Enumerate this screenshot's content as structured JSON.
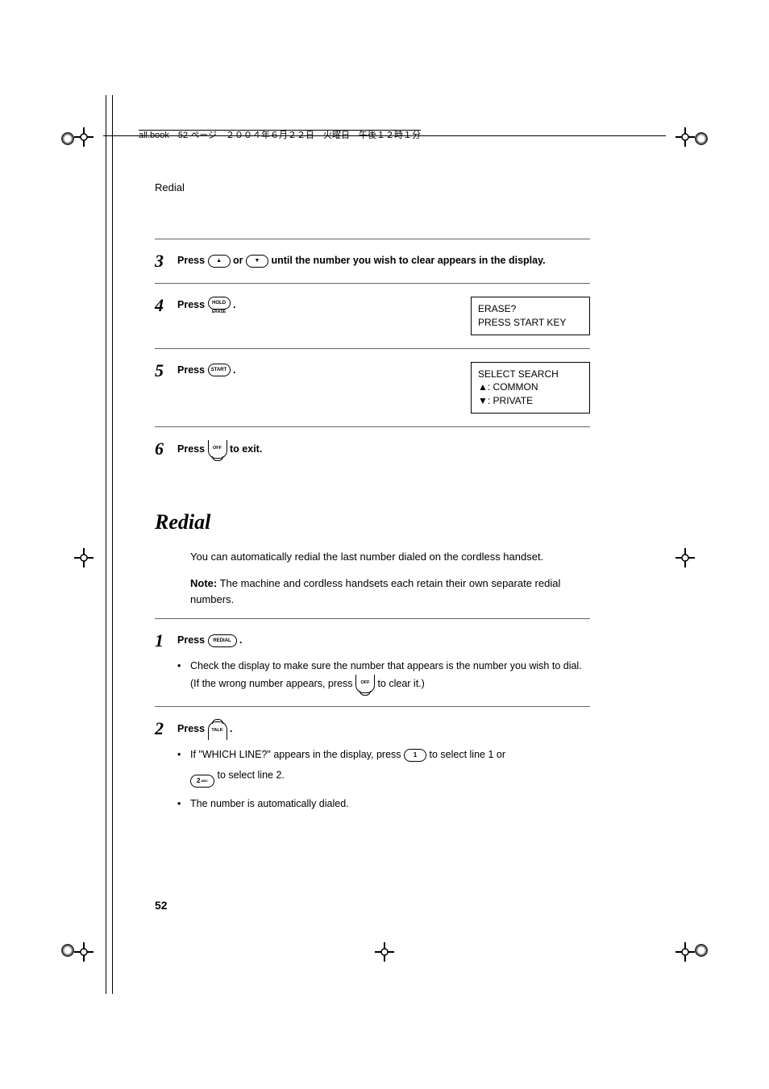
{
  "meta_line": "all.book　52 ページ　２００４年６月２２日　火曜日　午後１２時１分",
  "running_head": "Redial",
  "upper_steps": [
    {
      "num": "3",
      "text_before": "Press ",
      "text_mid": " or ",
      "text_after": " until the number you wish to clear appears in the display.",
      "icon1": "up-arrow-key",
      "icon2": "down-arrow-key"
    },
    {
      "num": "4",
      "text_before": "Press ",
      "text_after": " .",
      "icon": "hold-erase-key",
      "icon_main": "HOLD",
      "icon_sub": "ERASE",
      "display": [
        "ERASE?",
        "PRESS START KEY"
      ]
    },
    {
      "num": "5",
      "text_before": "Press ",
      "text_after": " .",
      "icon": "start-key",
      "icon_label": "START",
      "display": [
        "SELECT SEARCH",
        "▲: COMMON",
        "▼: PRIVATE"
      ]
    },
    {
      "num": "6",
      "text_before": "Press ",
      "text_after": " to exit.",
      "icon": "off-key",
      "icon_label": "OFF"
    }
  ],
  "section_title": "Redial",
  "intro_paras": [
    "You can automatically redial the last number dialed on the cordless handset."
  ],
  "note_label": "Note:",
  "note_text": " The machine and cordless handsets each retain their own separate redial numbers.",
  "lower_steps": [
    {
      "num": "1",
      "text_before": "Press ",
      "text_after": " .",
      "icon": "redial-key",
      "icon_label": "REDIAL",
      "bullets": [
        {
          "pre": "Check the display to make sure the number that appears is the number you wish to dial. (If the wrong number appears, press ",
          "mid_icon": "off-key",
          "mid_icon_label": "OFF",
          "post": " to clear it.)"
        }
      ]
    },
    {
      "num": "2",
      "text_before": "Press ",
      "text_after": " .",
      "icon": "talk-key",
      "icon_label": "TALK",
      "bullets": [
        {
          "pre": "If \"WHICH LINE?\" appears in the display, press ",
          "mid_icon": "key-1",
          "mid_icon_label": "1",
          "between": " to select line 1 or ",
          "mid_icon2": "key-2",
          "mid_icon2_label": "2",
          "mid_icon2_sub": "ABC",
          "post": " to select line 2."
        },
        {
          "pre": "The number is automatically dialed."
        }
      ]
    }
  ],
  "page_number": "52"
}
